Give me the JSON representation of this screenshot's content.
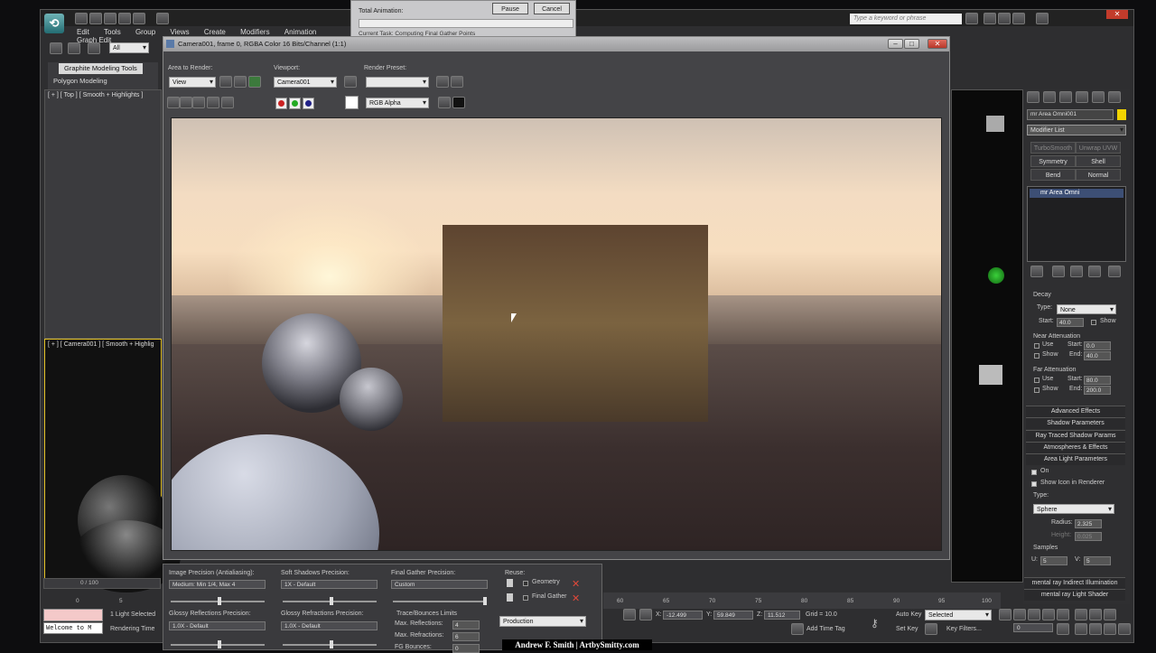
{
  "colors": {
    "accent_yellow": "#f2d400",
    "render_sky": "#f3dcc2",
    "progress_bg": "#c9c9cb"
  },
  "menu": [
    "Edit",
    "Tools",
    "Group",
    "Views",
    "Create",
    "Modifiers",
    "Animation",
    "Graph Edit"
  ],
  "toolbar": {
    "selection_filter": "All",
    "search_placeholder": "Type a keyword or phrase"
  },
  "ribbon": {
    "tab_active": "Graphite Modeling Tools",
    "tab_sub": "Polygon Modeling"
  },
  "viewports": {
    "top_label": "[ + ] [ Top ] [ Smooth + Highlights ]",
    "camera_label": "[ + ] [ Camera001 ] [ Smooth + Highlig"
  },
  "progress_dialog": {
    "total_animation": "Total Animation:",
    "pause": "Pause",
    "cancel": "Cancel",
    "current_task": "Current Task:     Computing Final Gather Points"
  },
  "render_frame": {
    "title": "Camera001, frame 0, RGBA Color 16 Bits/Channel (1:1)",
    "area_label": "Area to Render:",
    "area_value": "View",
    "viewport_label": "Viewport:",
    "viewport_value": "Camera001",
    "preset_label": "Render Preset:",
    "preset_value": "",
    "channel_value": "RGB Alpha"
  },
  "render_setup": {
    "image_precision_label": "Image Precision (Antialiasing):",
    "image_precision_value": "Medium: Min 1/4, Max 4",
    "soft_shadows_label": "Soft Shadows Precision:",
    "soft_shadows_value": "1X - Default",
    "fg_precision_label": "Final Gather Precision:",
    "fg_precision_value": "Custom",
    "glossy_refl_label": "Glossy Reflections Precision:",
    "glossy_refl_value": "1.0X - Default",
    "glossy_refr_label": "Glossy Refractions Precision:",
    "glossy_refr_value": "1.0X - Default",
    "trace_label": "Trace/Bounces Limits",
    "max_refl_label": "Max. Reflections:",
    "max_refl_value": "4",
    "max_refr_label": "Max. Refractions:",
    "max_refr_value": "6",
    "fg_bounces_label": "FG Bounces:",
    "fg_bounces_value": "0",
    "reuse_label": "Reuse:",
    "reuse_geometry": "Geometry",
    "reuse_fg": "Final Gather",
    "mode_value": "Production"
  },
  "command_panel": {
    "object_name": "mr Area Omni001",
    "modifier_list": "Modifier List",
    "buttons": [
      "TurboSmooth",
      "Unwrap UVW",
      "Symmetry",
      "Shell",
      "Bend",
      "Normal"
    ],
    "stack_item": "mr Area Omni",
    "decay_label": "Decay",
    "decay_type_label": "Type:",
    "decay_type_value": "None",
    "start_label": "Start:",
    "start_value": "40.0",
    "show_label": "Show",
    "near_atten_label": "Near Attenuation",
    "use_label": "Use",
    "near_start_value": "0.0",
    "near_end_value": "40.0",
    "end_label": "End:",
    "far_atten_label": "Far Attenuation",
    "far_start_value": "80.0",
    "far_end_value": "200.0",
    "rollouts": [
      "Advanced Effects",
      "Shadow Parameters",
      "Ray Traced Shadow Params",
      "Atmospheres & Effects",
      "Area Light Parameters"
    ],
    "on_label": "On",
    "show_icon_label": "Show Icon in Renderer",
    "shape_type_label": "Type:",
    "shape_type_value": "Sphere",
    "radius_label": "Radius:",
    "radius_value": "2.325",
    "height_label": "Height:",
    "height_value": "0.025",
    "samples_label": "Samples",
    "u_label": "U:",
    "u_value": "5",
    "v_label": "V:",
    "v_value": "5",
    "indirect_rollout": "mental ray Indirect Illumination",
    "shader_rollout": "mental ray Light Shader"
  },
  "status": {
    "frame_counter": "0 / 100",
    "welcome": "Welcome to M",
    "selected": "1 Light Selected",
    "rendering_time": "Rendering Time",
    "x_value": "-12.499",
    "y_value": "59.849",
    "z_value": "11.512",
    "grid": "Grid = 10.0",
    "add_time_tag": "Add Time Tag",
    "auto_key": "Auto Key",
    "set_key": "Set Key",
    "key_selected": "Selected",
    "key_filters": "Key Filters...",
    "frame_field": "0",
    "ticks_left": [
      "0",
      "5"
    ],
    "ticks_right": [
      "60",
      "65",
      "70",
      "75",
      "80",
      "85",
      "90",
      "95",
      "100"
    ]
  },
  "watermark": "Andrew F. Smith | ArtbySmitty.com"
}
